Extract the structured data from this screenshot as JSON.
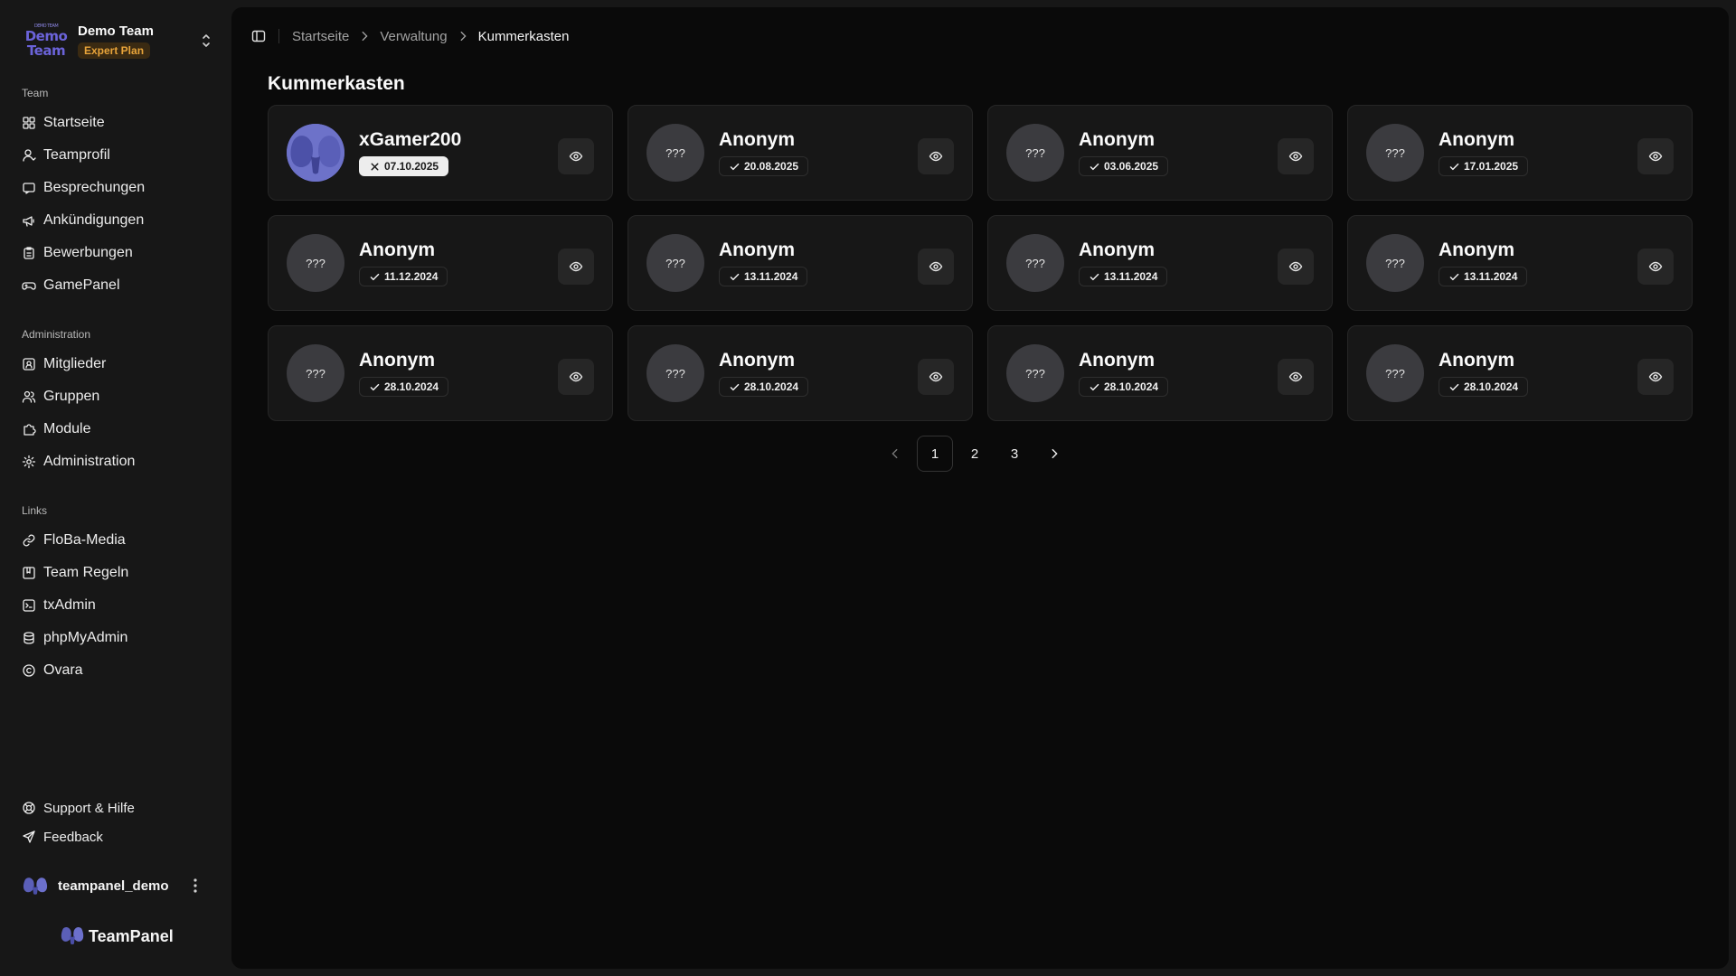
{
  "team": {
    "logo_small": "DEMO TEAM",
    "logo_line1": "Demo",
    "logo_line2": "Team",
    "name": "Demo Team",
    "plan": "Expert Plan"
  },
  "sidebar": {
    "sections": [
      {
        "label": "Team",
        "items": [
          {
            "label": "Startseite",
            "icon": "dashboard-icon"
          },
          {
            "label": "Teamprofil",
            "icon": "user-icon"
          },
          {
            "label": "Besprechungen",
            "icon": "chat-icon"
          },
          {
            "label": "Ankündigungen",
            "icon": "megaphone-icon"
          },
          {
            "label": "Bewerbungen",
            "icon": "clipboard-icon"
          },
          {
            "label": "GamePanel",
            "icon": "gamepad-icon"
          }
        ]
      },
      {
        "label": "Administration",
        "items": [
          {
            "label": "Mitglieder",
            "icon": "contact-icon"
          },
          {
            "label": "Gruppen",
            "icon": "users-icon"
          },
          {
            "label": "Module",
            "icon": "puzzle-icon"
          },
          {
            "label": "Administration",
            "icon": "gear-icon"
          }
        ]
      },
      {
        "label": "Links",
        "items": [
          {
            "label": "FloBa-Media",
            "icon": "link-icon"
          },
          {
            "label": "Team Regeln",
            "icon": "rules-icon"
          },
          {
            "label": "txAdmin",
            "icon": "terminal-icon"
          },
          {
            "label": "phpMyAdmin",
            "icon": "database-icon"
          },
          {
            "label": "Ovara",
            "icon": "copyright-icon"
          }
        ]
      }
    ],
    "footer_items": [
      {
        "label": "Support & Hilfe",
        "icon": "lifebuoy-icon"
      },
      {
        "label": "Feedback",
        "icon": "send-icon"
      }
    ],
    "user": {
      "name": "teampanel_demo"
    },
    "brand": "TeamPanel"
  },
  "breadcrumb": [
    "Startseite",
    "Verwaltung",
    "Kummerkasten"
  ],
  "page": {
    "title": "Kummerkasten"
  },
  "cards": [
    {
      "name": "xGamer200",
      "date": "07.10.2025",
      "status": "closed",
      "avatar": "image",
      "initials": ""
    },
    {
      "name": "Anonym",
      "date": "20.08.2025",
      "status": "done",
      "avatar": "placeholder",
      "initials": "???"
    },
    {
      "name": "Anonym",
      "date": "03.06.2025",
      "status": "done",
      "avatar": "placeholder",
      "initials": "???"
    },
    {
      "name": "Anonym",
      "date": "17.01.2025",
      "status": "done",
      "avatar": "placeholder",
      "initials": "???"
    },
    {
      "name": "Anonym",
      "date": "11.12.2024",
      "status": "done",
      "avatar": "placeholder",
      "initials": "???"
    },
    {
      "name": "Anonym",
      "date": "13.11.2024",
      "status": "done",
      "avatar": "placeholder",
      "initials": "???"
    },
    {
      "name": "Anonym",
      "date": "13.11.2024",
      "status": "done",
      "avatar": "placeholder",
      "initials": "???"
    },
    {
      "name": "Anonym",
      "date": "13.11.2024",
      "status": "done",
      "avatar": "placeholder",
      "initials": "???"
    },
    {
      "name": "Anonym",
      "date": "28.10.2024",
      "status": "done",
      "avatar": "placeholder",
      "initials": "???"
    },
    {
      "name": "Anonym",
      "date": "28.10.2024",
      "status": "done",
      "avatar": "placeholder",
      "initials": "???"
    },
    {
      "name": "Anonym",
      "date": "28.10.2024",
      "status": "done",
      "avatar": "placeholder",
      "initials": "???"
    },
    {
      "name": "Anonym",
      "date": "28.10.2024",
      "status": "done",
      "avatar": "placeholder",
      "initials": "???"
    }
  ],
  "pagination": {
    "pages": [
      "1",
      "2",
      "3"
    ],
    "current": "1"
  },
  "colors": {
    "accent": "#e8a43a",
    "avatar_brand": "#5b5fb8",
    "background": "#0a0a0a",
    "sidebar": "#171717"
  }
}
